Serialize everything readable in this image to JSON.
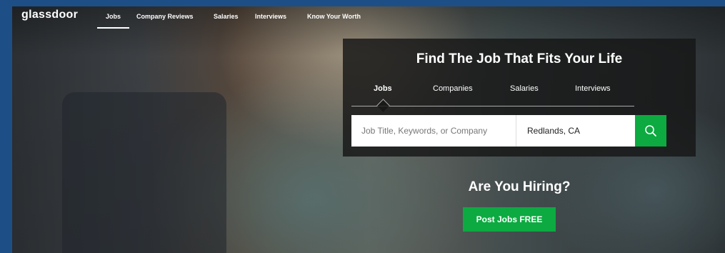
{
  "brand": {
    "logo_text": "glassdoor"
  },
  "nav": {
    "items": [
      {
        "label": "Jobs",
        "active": true
      },
      {
        "label": "Company Reviews"
      },
      {
        "label": "Salaries"
      },
      {
        "label": "Interviews"
      },
      {
        "label": "Know Your Worth"
      }
    ]
  },
  "search": {
    "headline": "Find The Job That Fits Your Life",
    "tabs": [
      {
        "label": "Jobs",
        "active": true
      },
      {
        "label": "Companies"
      },
      {
        "label": "Salaries"
      },
      {
        "label": "Interviews"
      }
    ],
    "keyword_placeholder": "Job Title, Keywords, or Company",
    "location_value": "Redlands, CA",
    "button_icon": "search-icon"
  },
  "hiring": {
    "heading": "Are You Hiring?",
    "cta_label": "Post Jobs FREE"
  },
  "colors": {
    "accent_green": "#0caa41",
    "page_border_blue": "#1d4f86"
  }
}
